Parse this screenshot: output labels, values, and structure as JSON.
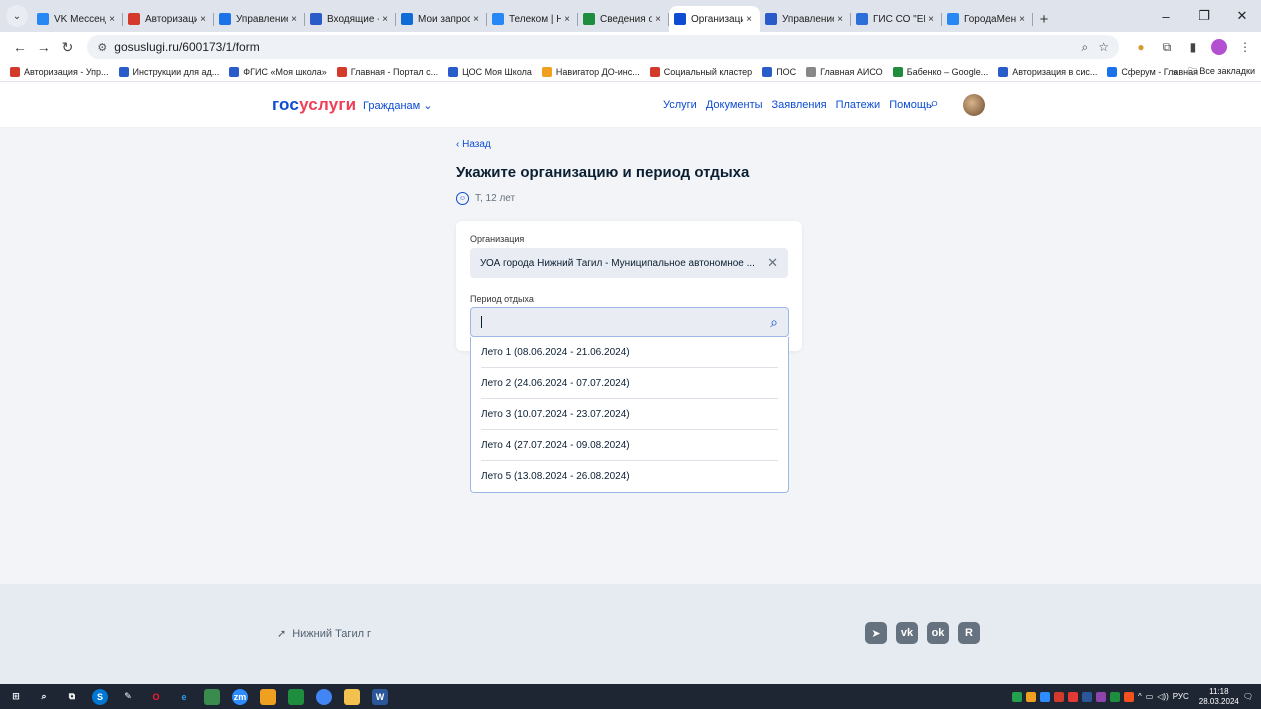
{
  "browser": {
    "tabs": [
      {
        "title": "VK Мессенджер",
        "color": "#2787f5",
        "active": false
      },
      {
        "title": "Авторизация",
        "color": "#d43a2c",
        "active": false
      },
      {
        "title": "Управление С",
        "color": "#1a73e8",
        "active": false
      },
      {
        "title": "Входящие - П",
        "color": "#2a5cc9",
        "active": false
      },
      {
        "title": "Мои запросы",
        "color": "#0f6bd6",
        "active": false
      },
      {
        "title": "Телеком | Нов",
        "color": "#2787f5",
        "active": false
      },
      {
        "title": "Сведения о п",
        "color": "#1e8e3e",
        "active": false
      },
      {
        "title": "Организация",
        "color": "#0d4cd3",
        "active": true
      },
      {
        "title": "Управление о",
        "color": "#2a5cc9",
        "active": false
      },
      {
        "title": "ГИС СО \"ЕЦП\"",
        "color": "#2c6fd8",
        "active": false
      },
      {
        "title": "ГородаМеняю",
        "color": "#2787f5",
        "active": false
      }
    ],
    "tab_close": "×",
    "new_tab": "+",
    "window": {
      "minimize": "–",
      "restore": "❐",
      "close": "✕"
    },
    "url": "gosuslugi.ru/600173/1/form",
    "bookmarks": [
      {
        "label": "Авторизация - Упр...",
        "color": "#d43a2c"
      },
      {
        "label": "Инструкции для ад...",
        "color": "#2a5cc9"
      },
      {
        "label": "ФГИС «Моя школа»",
        "color": "#2a5cc9"
      },
      {
        "label": "Главная - Портал с...",
        "color": "#d43a2c"
      },
      {
        "label": "ЦОС Моя Школа",
        "color": "#2a5cc9"
      },
      {
        "label": "Навигатор ДО-инс...",
        "color": "#f0a020"
      },
      {
        "label": "Социальный кластер",
        "color": "#d43a2c"
      },
      {
        "label": "ПОС",
        "color": "#2a5cc9"
      },
      {
        "label": "Главная АИСО",
        "color": "#888888"
      },
      {
        "label": "Бабенко – Google...",
        "color": "#1e8e3e"
      },
      {
        "label": "Авторизация в сис...",
        "color": "#2a5cc9"
      },
      {
        "label": "Сферум - Главная",
        "color": "#1a73e8"
      }
    ],
    "bookmarks_more": "»",
    "all_bookmarks": "Все закладки"
  },
  "site": {
    "logo_part1": "гос",
    "logo_part2": "услуги",
    "citizens": "Гражданам ⌄",
    "menu": [
      "Услуги",
      "Документы",
      "Заявления",
      "Платежи",
      "Помощь"
    ]
  },
  "form": {
    "back": "‹ Назад",
    "title": "Укажите организацию и период отдыха",
    "child": "Т, 12 лет",
    "org_label": "Организация",
    "org_value": "УОА города Нижний Тагил - Муниципальное автономное ...",
    "period_label": "Период отдыха",
    "period_value": "",
    "options": [
      "Лето 1 (08.06.2024 - 21.06.2024)",
      "Лето 2 (24.06.2024 - 07.07.2024)",
      "Лето 3 (10.07.2024 - 23.07.2024)",
      "Лето 4 (27.07.2024 - 09.08.2024)",
      "Лето 5 (13.08.2024 - 26.08.2024)"
    ]
  },
  "footer": {
    "location": "Нижний Тагил г",
    "socials": [
      "telegram-icon",
      "vk-icon",
      "ok-icon",
      "rutube-icon"
    ]
  },
  "taskbar": {
    "lang": "РУС",
    "time": "11:18",
    "date": "28.03.2024"
  }
}
